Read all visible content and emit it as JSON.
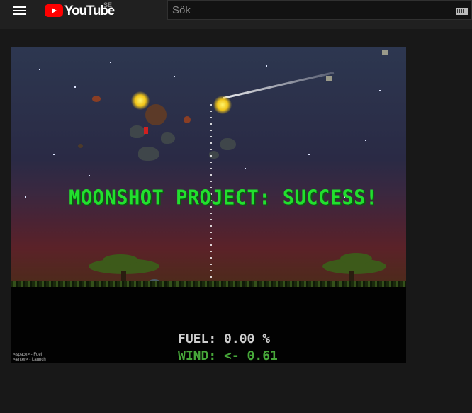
{
  "masthead": {
    "logo_text": "YouTube",
    "country_code": "SE",
    "search_placeholder": "Sök",
    "icons": [
      "menu-icon",
      "youtube-play-icon",
      "keyboard-icon"
    ],
    "colors": {
      "bar": "#202020",
      "logo_red": "#ff0000"
    }
  },
  "video": {
    "headline": "MOONSHOT PROJECT: SUCCESS!",
    "fuel_label": "FUEL: 0.00 %",
    "wind_label": "WIND: <- 0.61",
    "controls_hint_1": "<space> - Fuel",
    "controls_hint_2": "<enter> - Launch",
    "colors": {
      "headline": "#22e02e",
      "wind": "#47a83a",
      "fuel": "#cfcfcf"
    }
  }
}
